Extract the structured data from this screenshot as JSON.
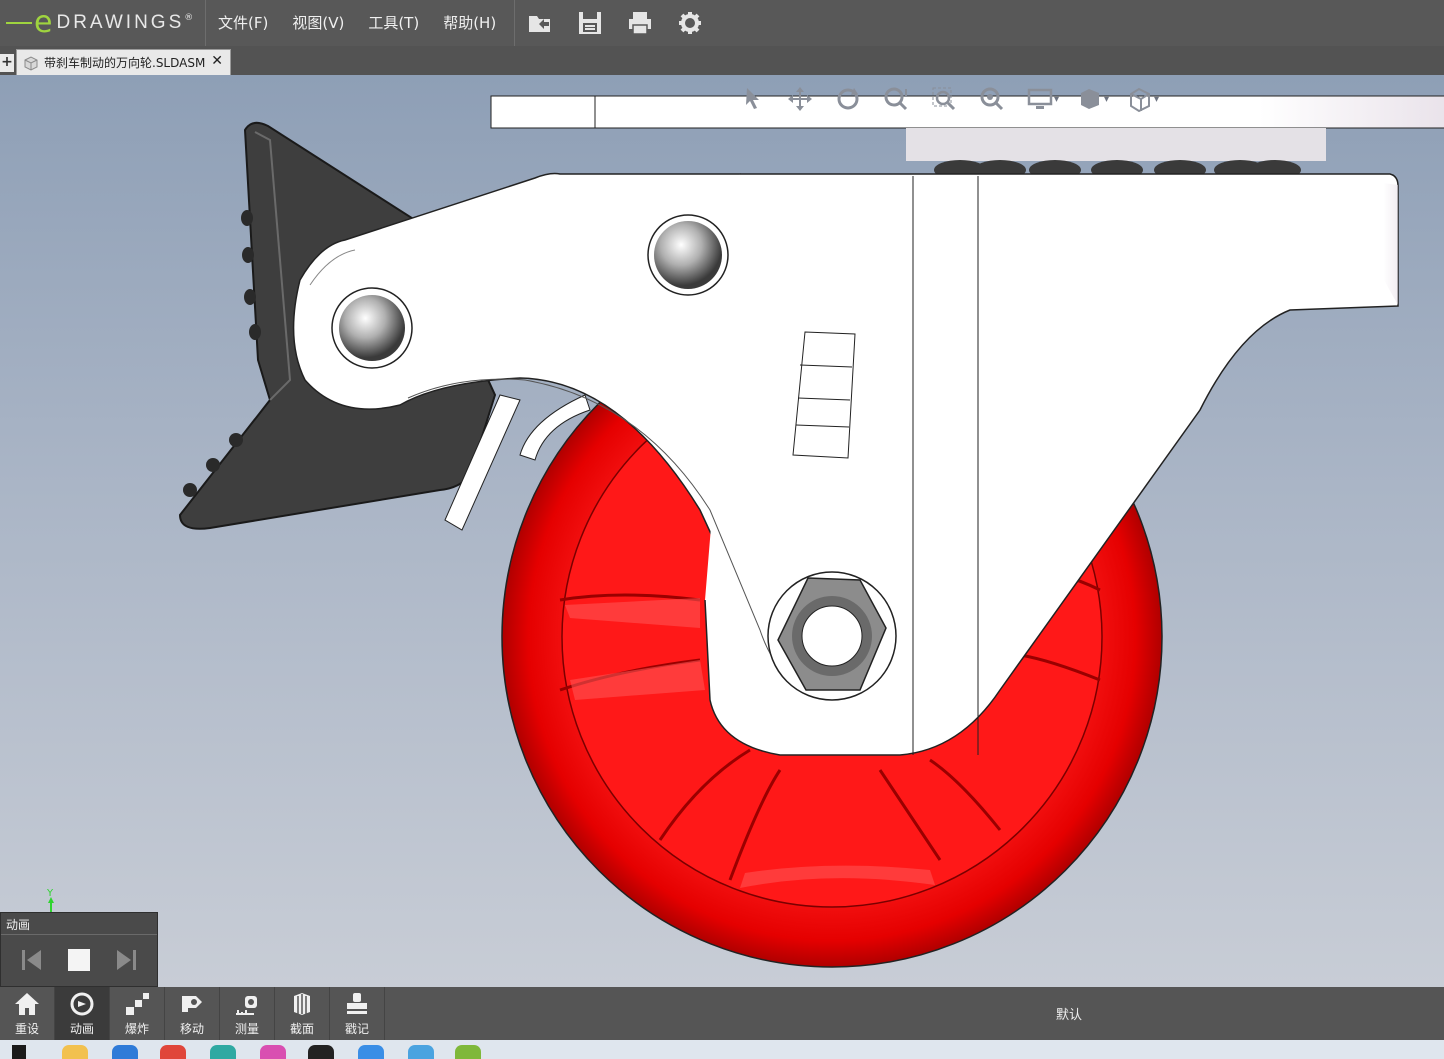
{
  "app": {
    "logo_e": "e",
    "logo_text": "DRAWINGS",
    "logo_mark": "®"
  },
  "menu": {
    "items": [
      "文件(F)",
      "视图(V)",
      "工具(T)",
      "帮助(H)"
    ]
  },
  "toolbar_icons": [
    "open-icon",
    "save-icon",
    "print-icon",
    "settings-icon"
  ],
  "tab": {
    "add_label": "+",
    "title": "带刹车制动的万向轮.SLDASM",
    "close_label": "✕"
  },
  "view_toolbar": [
    "select-icon",
    "pan-icon",
    "rotate-icon",
    "zoom-icon",
    "zoom-to-area-icon",
    "zoom-to-fit-icon",
    "display-style-icon",
    "shading-icon",
    "view-orientation-icon"
  ],
  "triad": {
    "axis_label": "Y"
  },
  "animation_panel": {
    "title": "动画",
    "controls": [
      "rewind-icon",
      "stop-icon",
      "forward-icon"
    ]
  },
  "bottom_toolbar": {
    "items": [
      {
        "label": "重设",
        "icon": "home-icon"
      },
      {
        "label": "动画",
        "icon": "animation-icon"
      },
      {
        "label": "爆炸",
        "icon": "explode-icon"
      },
      {
        "label": "移动",
        "icon": "move-icon"
      },
      {
        "label": "测量",
        "icon": "measure-icon"
      },
      {
        "label": "截面",
        "icon": "section-icon"
      },
      {
        "label": "戳记",
        "icon": "stamp-icon"
      }
    ],
    "configuration": "默认"
  },
  "colors": {
    "wheel": "#ff1a1a",
    "bracket": "#ffffff",
    "brake": "#3c3c3c",
    "accent": "#9fd43f"
  }
}
